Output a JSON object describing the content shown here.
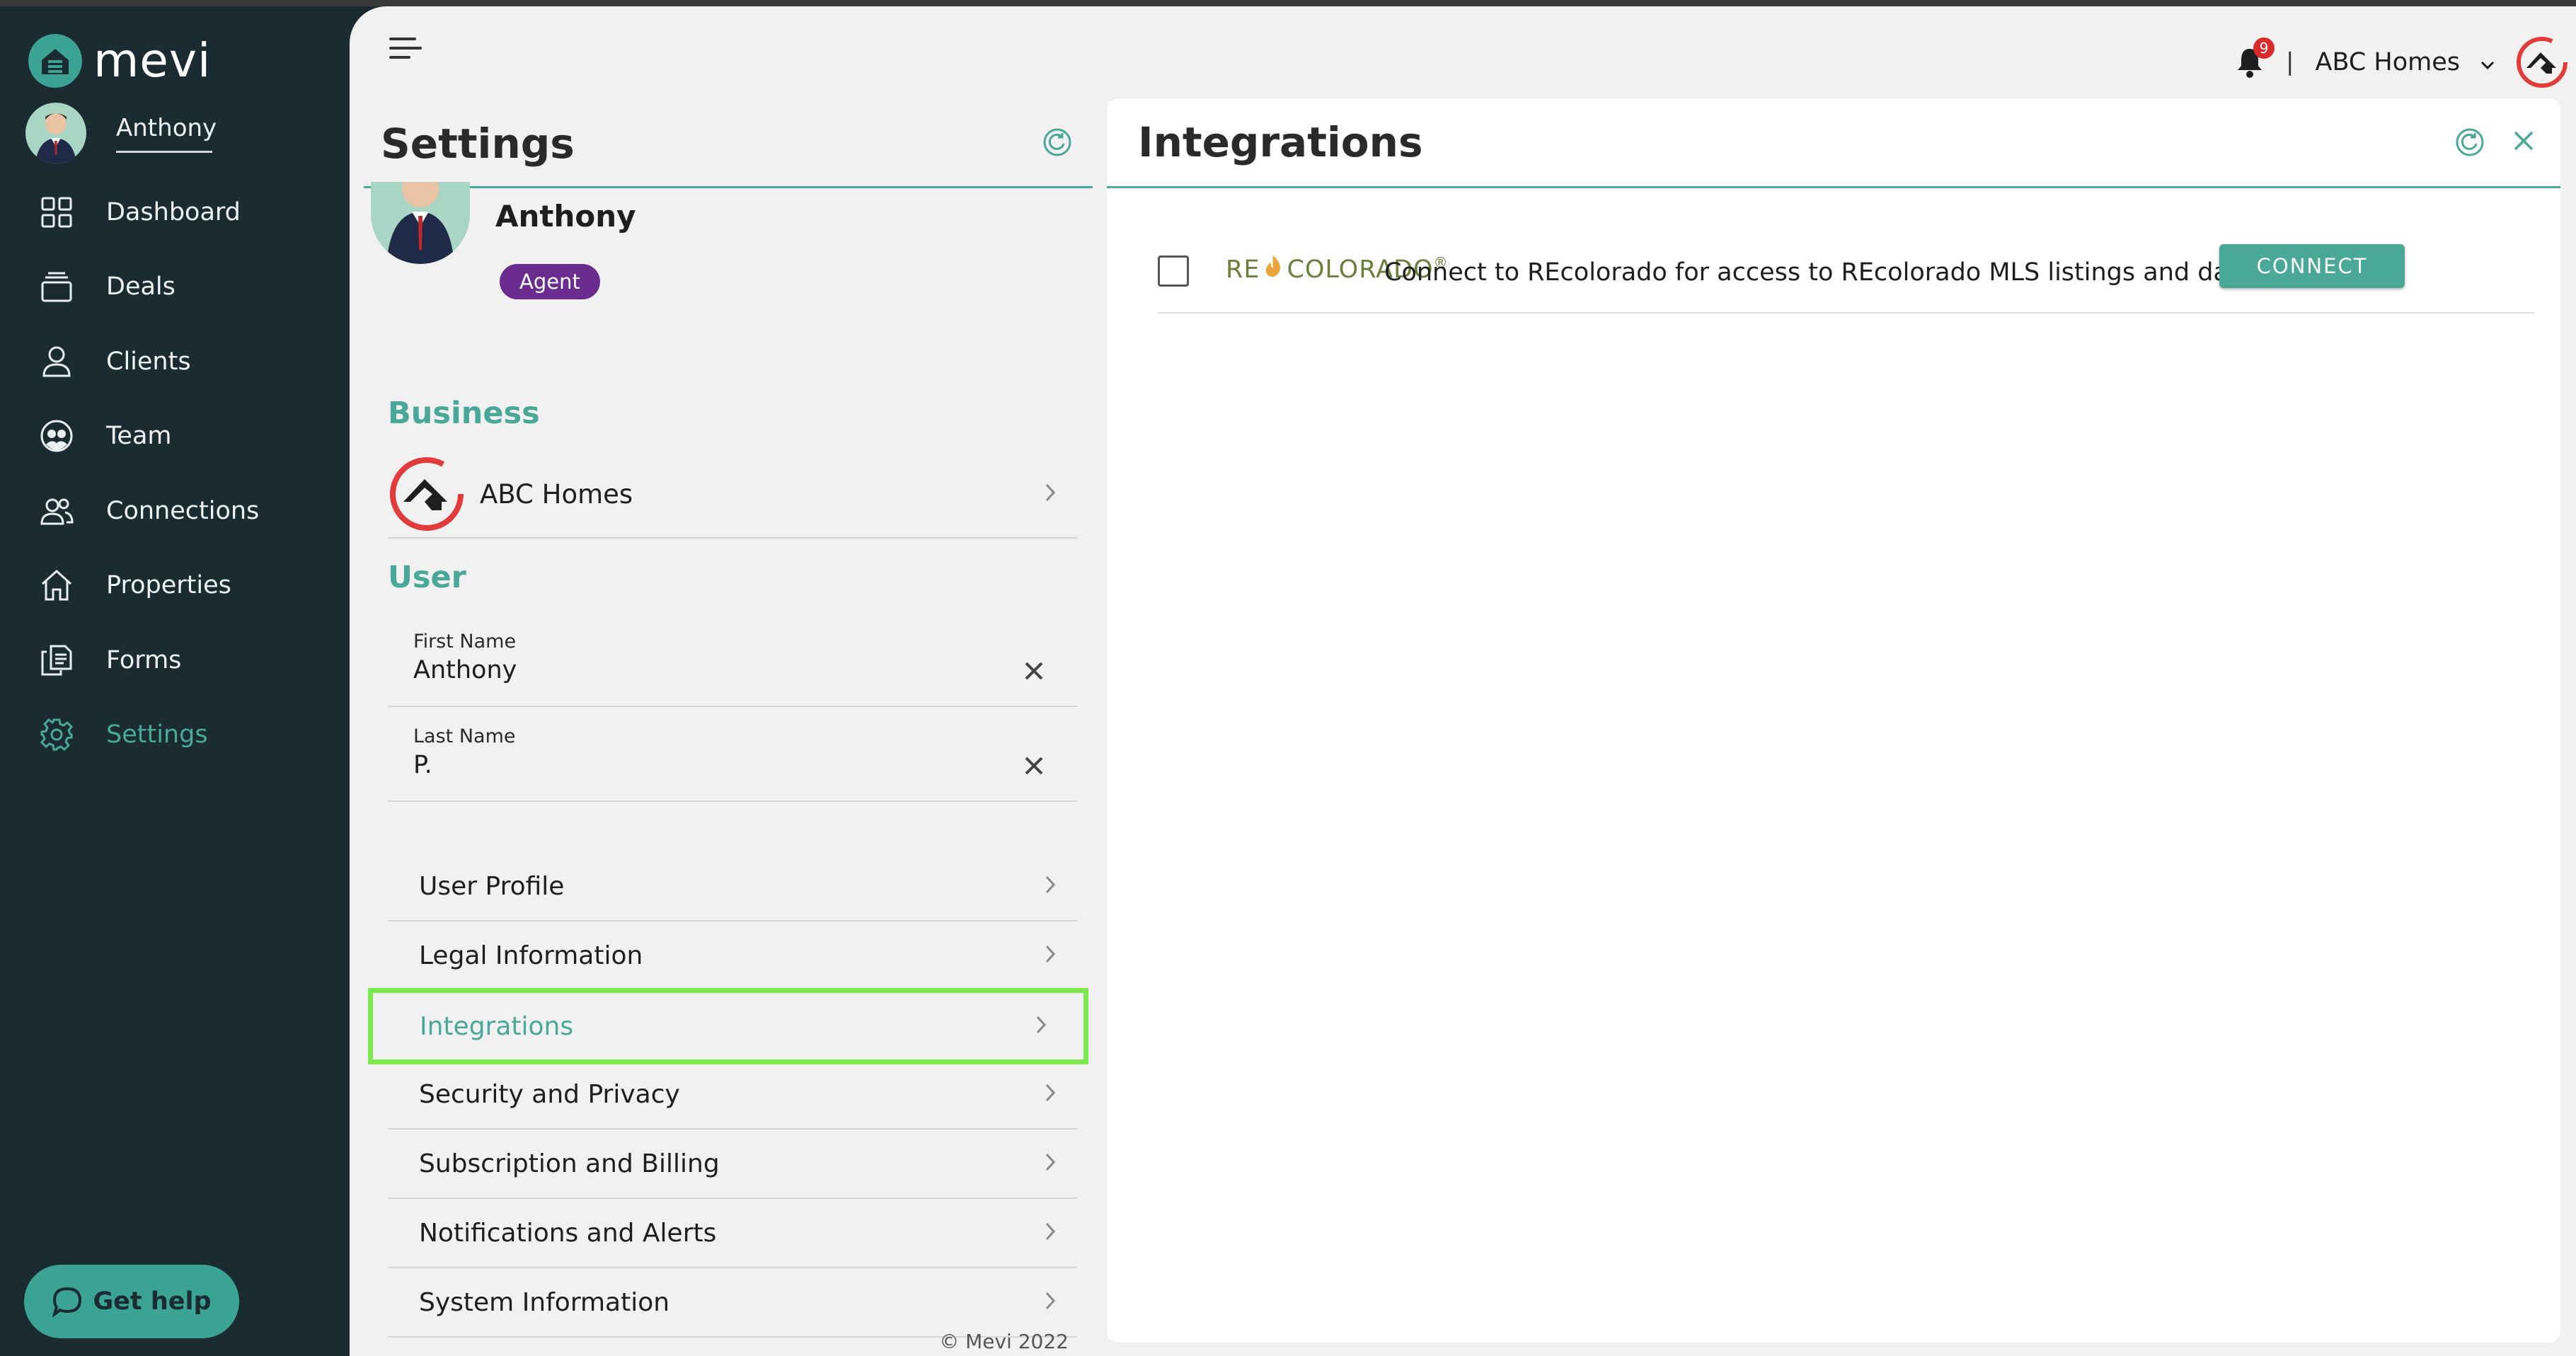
{
  "app": {
    "name": "mevi"
  },
  "user": {
    "name": "Anthony"
  },
  "nav": [
    {
      "id": "dashboard",
      "label": "Dashboard",
      "icon": "grid-icon"
    },
    {
      "id": "deals",
      "label": "Deals",
      "icon": "stack-icon"
    },
    {
      "id": "clients",
      "label": "Clients",
      "icon": "person-icon"
    },
    {
      "id": "team",
      "label": "Team",
      "icon": "team-icon"
    },
    {
      "id": "connections",
      "label": "Connections",
      "icon": "people-icon"
    },
    {
      "id": "properties",
      "label": "Properties",
      "icon": "house-icon"
    },
    {
      "id": "forms",
      "label": "Forms",
      "icon": "documents-icon"
    },
    {
      "id": "settings",
      "label": "Settings",
      "icon": "gear-icon",
      "active": true
    }
  ],
  "help": {
    "label": "Get help"
  },
  "topbar": {
    "notification_count": "9",
    "separator": "|",
    "company": "ABC Homes"
  },
  "settings": {
    "title": "Settings",
    "profile_name": "Anthony",
    "role_badge": "Agent",
    "business_heading": "Business",
    "business_name": "ABC Homes",
    "user_heading": "User",
    "first_name_label": "First Name",
    "first_name_value": "Anthony",
    "last_name_label": "Last Name",
    "last_name_value": "P.",
    "menu": [
      "User Profile",
      "Legal Information",
      "Integrations",
      "Security and Privacy",
      "Subscription and Billing",
      "Notifications and Alerts",
      "System Information"
    ],
    "selected_menu": "Integrations",
    "copyright": "© Mevi 2022"
  },
  "integrations": {
    "title": "Integrations",
    "items": [
      {
        "logo_left": "RE",
        "logo_right": "COLORADO",
        "logo_mark": "®",
        "description": "Connect to REcolorado for access to REcolorado MLS listings and data.",
        "button": "CONNECT"
      }
    ]
  },
  "colors": {
    "accent": "#4aa898",
    "sidebar": "#1b2b32",
    "badge": "#6a2c8f",
    "highlight": "#7ee84f",
    "notification": "#d92b2b"
  }
}
